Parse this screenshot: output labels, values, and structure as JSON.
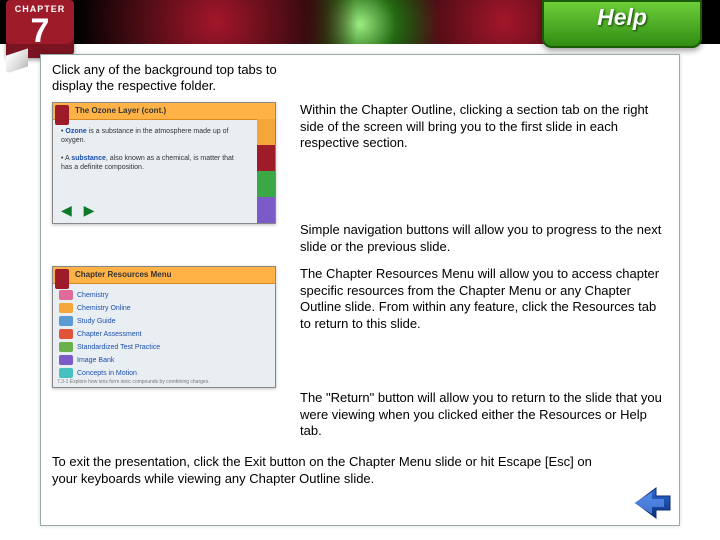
{
  "chapter": {
    "label": "CHAPTER",
    "number": "7"
  },
  "help_tab": {
    "label": "Help"
  },
  "intro": "Click any of the background top tabs to display the respective folder.",
  "para": {
    "outline": "Within the Chapter Outline, clicking a section tab on the right side of the screen will bring you to the first slide in each respective section.",
    "nav": "Simple navigation buttons will allow you to progress to the next slide or the previous slide.",
    "resources": "The Chapter Resources Menu will allow you to access chapter specific resources from the Chapter Menu or any Chapter Outline slide. From within any feature, click the Resources tab to return to this slide.",
    "return": "The \"Return\" button will allow you to return to the slide that you were viewing when you clicked either the Resources or Help tab."
  },
  "exit": "To exit the presentation, click the Exit button on the Chapter Menu slide or hit Escape [Esc] on your keyboards while viewing any Chapter Outline slide.",
  "thumb1": {
    "title": "The Ozone Layer (cont.)",
    "bullets_html": "• <b>Ozone</b> is a substance in the atmosphere made up of oxygen.<br><br>• A <b>substance</b>, also known as a chemical, is matter that has a definite composition.",
    "side_colors": [
      "#f4a63a",
      "#9e1b2a",
      "#39a845",
      "#7a5bc7"
    ],
    "nav_glyphs": "◀ ▶"
  },
  "thumb2": {
    "title": "Chapter Resources Menu",
    "items": [
      {
        "color": "#e06a9a",
        "label": "Chemistry"
      },
      {
        "color": "#f4a63a",
        "label": "Chemistry Online"
      },
      {
        "color": "#5a9bd4",
        "label": "Study Guide"
      },
      {
        "color": "#e0543a",
        "label": "Chapter Assessment"
      },
      {
        "color": "#6ab04c",
        "label": "Standardized Test Practice"
      },
      {
        "color": "#7a5bc7",
        "label": "Image Bank"
      },
      {
        "color": "#47c1bf",
        "label": "Concepts in Motion"
      }
    ],
    "footer": "7.3-1  Explore how ions form ionic compounds by combining charges."
  }
}
